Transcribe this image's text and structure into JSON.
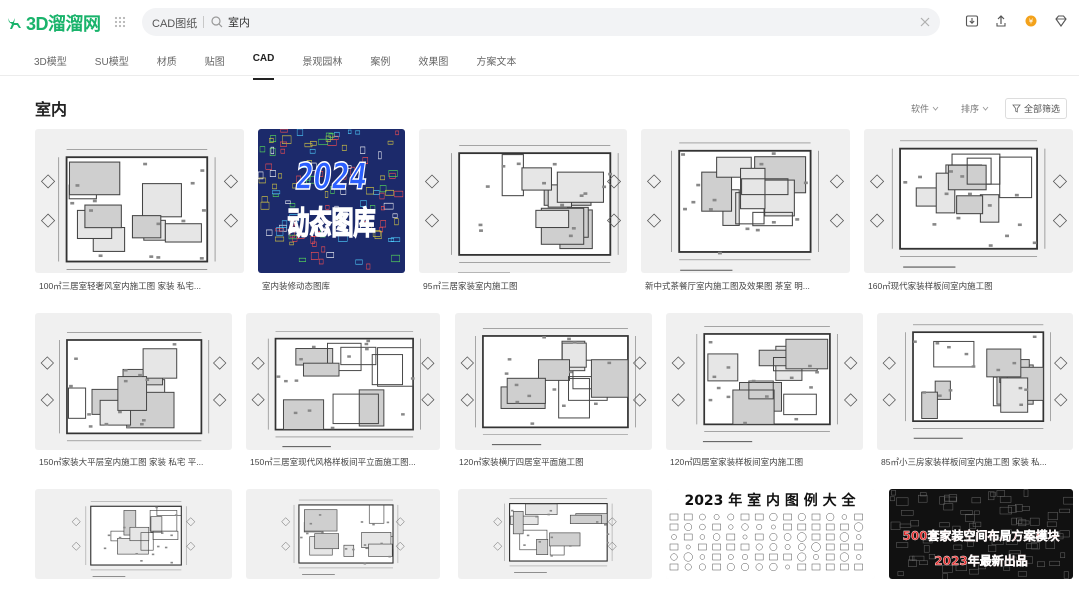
{
  "header": {
    "logo_text": "3D溜溜网",
    "search": {
      "category": "CAD图纸",
      "value": "室内",
      "placeholder": ""
    }
  },
  "nav": {
    "items": [
      {
        "label": "3D模型",
        "active": false
      },
      {
        "label": "SU模型",
        "active": false
      },
      {
        "label": "材质",
        "active": false
      },
      {
        "label": "贴图",
        "active": false
      },
      {
        "label": "CAD",
        "active": true
      },
      {
        "label": "景观园林",
        "active": false
      },
      {
        "label": "案例",
        "active": false
      },
      {
        "label": "效果图",
        "active": false
      },
      {
        "label": "方案文本",
        "active": false
      }
    ]
  },
  "page": {
    "title": "室内",
    "filters": {
      "software": "软件",
      "sort": "排序",
      "all": "全部筛选"
    }
  },
  "cards": [
    {
      "caption": "100㎡三居室轻奢风室内施工图 家装 私宅...",
      "style": "plan"
    },
    {
      "caption": "室内装修动态图库",
      "style": "library",
      "overlay_title": "2024",
      "overlay_subtitle": "动态图库"
    },
    {
      "caption": "95㎡三居家装室内施工图",
      "style": "plan"
    },
    {
      "caption": "新中式茶餐厅室内施工图及效果图 茶室 明...",
      "style": "plan"
    },
    {
      "caption": "160㎡现代家装样板间室内施工图",
      "style": "plan"
    },
    {
      "caption": "150㎡家装大平层室内施工图 家装 私宅 平...",
      "style": "plan"
    },
    {
      "caption": "150㎡三居室现代风格样板间平立面施工图...",
      "style": "plan"
    },
    {
      "caption": "120㎡家装横厅四居室平面施工图",
      "style": "plan"
    },
    {
      "caption": "120㎡四居室家装样板间室内施工图",
      "style": "plan"
    },
    {
      "caption": "85㎡小三房家装样板间室内施工图 家装 私...",
      "style": "plan"
    },
    {
      "caption": "",
      "style": "plan"
    },
    {
      "caption": "",
      "style": "plan"
    },
    {
      "caption": "",
      "style": "plan"
    },
    {
      "caption": "",
      "style": "legend",
      "overlay_title": "2023 年 室 内 图 例 大 全"
    },
    {
      "caption": "",
      "style": "dark",
      "overlay_title": "500套家装空间布局方案模块",
      "overlay_subtitle": "2023年最新出品"
    }
  ],
  "colors": {
    "brand": "#19b36b",
    "library_bg": "#1c2a6b",
    "dark_bg": "#111111",
    "accent_red": "#e22a2a"
  }
}
